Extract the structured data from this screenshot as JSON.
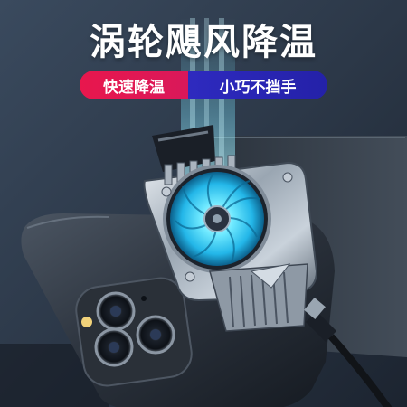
{
  "headline": "涡轮飓风降温",
  "badges": {
    "left": "快速降温",
    "right": "小巧不挡手"
  },
  "colors": {
    "background": "#2d3a4c",
    "badge_left": "#e8174d",
    "badge_right": "#2e2abf",
    "fan_glow": "#35d8ff"
  }
}
